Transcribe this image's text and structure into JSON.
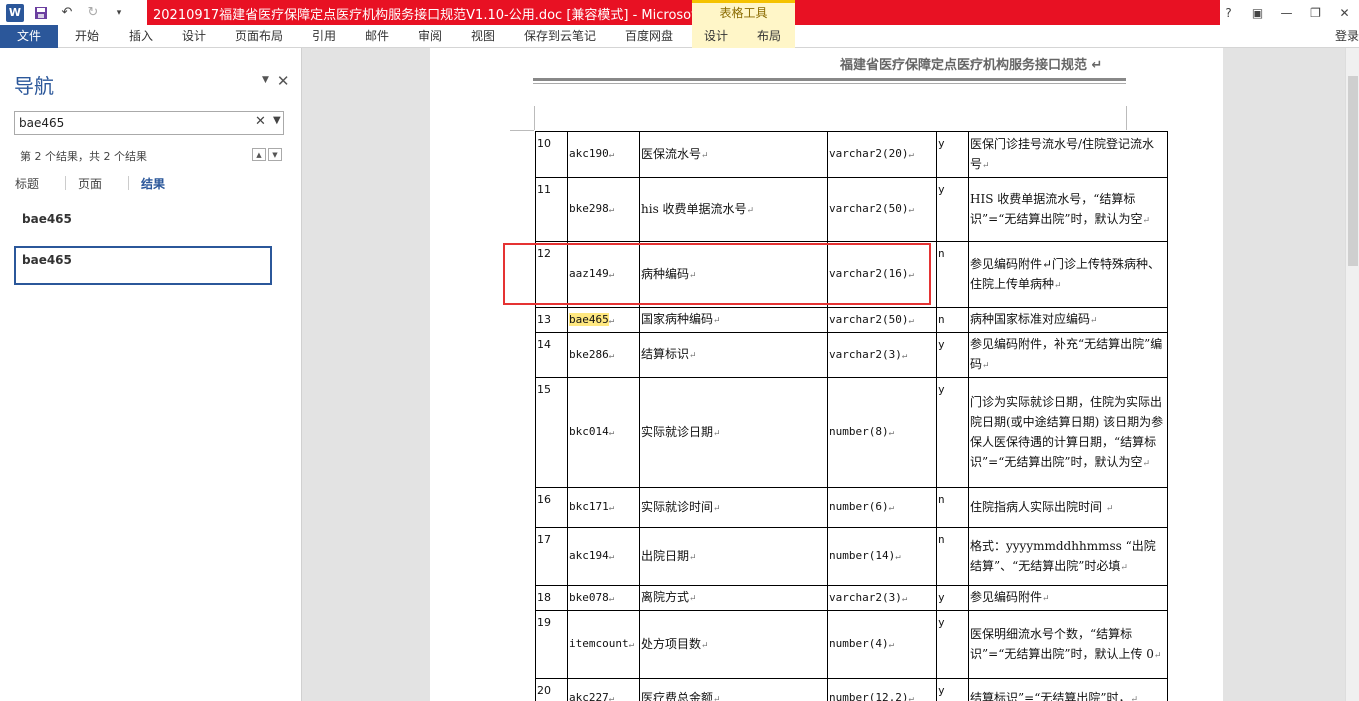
{
  "window": {
    "title": "20210917福建省医疗保障定点医疗机构服务接口规范V1.10-公用.doc [兼容模式] -  Microsoft...",
    "context_tab_group": "表格工具",
    "login": "登录"
  },
  "ribbon": {
    "tabs": [
      "开始",
      "插入",
      "设计",
      "页面布局",
      "引用",
      "邮件",
      "审阅",
      "视图",
      "保存到云笔记",
      "百度网盘"
    ],
    "file_tab": "文件",
    "context_tabs": [
      "设计",
      "布局"
    ]
  },
  "nav": {
    "title": "导航",
    "search_value": "bae465",
    "result_count": "第 2 个结果，共 2 个结果",
    "tabs": [
      "标题",
      "页面",
      "结果"
    ],
    "results": [
      "bae465",
      "bae465"
    ]
  },
  "document": {
    "header": "福建省医疗保障定点医疗机构服务接口规范 ↵",
    "rows": [
      {
        "no": "10",
        "code": "akc190",
        "name": "医保流水号",
        "type": "varchar2(20)",
        "req": "y",
        "desc": "医保门诊挂号流水号/住院登记流水号"
      },
      {
        "no": "11",
        "code": "bke298",
        "name": "his 收费单据流水号",
        "type": "varchar2(50)",
        "req": "y",
        "desc": "HIS 收费单据流水号，“结算标识”=“无结算出院”时，默认为空"
      },
      {
        "no": "12",
        "code": "aaz149",
        "name": "病种编码",
        "type": "varchar2(16)",
        "req": "n",
        "desc": "参见编码附件↵门诊上传特殊病种、住院上传单病种"
      },
      {
        "no": "13",
        "code": "bae465",
        "name": "国家病种编码",
        "type": "varchar2(50)",
        "req": "n",
        "desc": "病种国家标准对应编码"
      },
      {
        "no": "14",
        "code": "bke286",
        "name": "结算标识",
        "type": "varchar2(3)",
        "req": "y",
        "desc": "参见编码附件，补充“无结算出院”编码"
      },
      {
        "no": "15",
        "code": "bkc014",
        "name": "实际就诊日期",
        "type": "number(8)",
        "req": "y",
        "desc": "门诊为实际就诊日期，住院为实际出院日期(或中途结算日期) 该日期为参保人医保待遇的计算日期，“结算标识”=“无结算出院”时，默认为空"
      },
      {
        "no": "16",
        "code": "bkc171",
        "name": "实际就诊时间",
        "type": "number(6)",
        "req": "n",
        "desc": "住院指病人实际出院时间 "
      },
      {
        "no": "17",
        "code": "akc194",
        "name": "出院日期",
        "type": "number(14)",
        "req": "n",
        "desc": "格式：yyyymmddhhmmss “出院结算”、“无结算出院”时必填"
      },
      {
        "no": "18",
        "code": "bke078",
        "name": "离院方式",
        "type": "varchar2(3)",
        "req": "y",
        "desc": "参见编码附件"
      },
      {
        "no": "19",
        "code": "itemcount",
        "name": "处方项目数",
        "type": "number(4)",
        "req": "y",
        "desc": "医保明细流水号个数，“结算标识”=“无结算出院”时，默认上传 0"
      },
      {
        "no": "20",
        "code": "akc227",
        "name": "医疗费总金额",
        "type": "number(12,2)",
        "req": "y",
        "desc": "结算标识”=“无结算出院”时，"
      }
    ]
  },
  "colors": {
    "brand": "#2b579a",
    "title_red": "#e81123",
    "highlight": "#ffe880",
    "annotation_red": "#e53333"
  }
}
